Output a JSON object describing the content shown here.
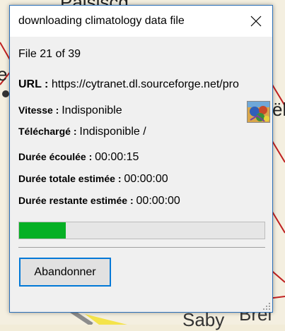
{
  "background_map": {
    "labels": [
      "Palsiscd",
      "e",
      "ël",
      "Saby",
      "Brei"
    ]
  },
  "dialog": {
    "title": "downloading climatology data file",
    "file_counter": "File 21 of 39",
    "url_label": "URL :",
    "url_value": "https://cytranet.dl.sourceforge.net/pro",
    "speed_label": "Vitesse :",
    "speed_value": "Indisponible",
    "downloaded_label": "Téléchargé :",
    "downloaded_value": "Indisponible /",
    "elapsed_label": "Durée écoulée :",
    "elapsed_value": "00:00:15",
    "total_label": "Durée totale estimée :",
    "total_value": "00:00:00",
    "remaining_label": "Durée restante estimée :",
    "remaining_value": "00:00:00",
    "progress_percent": 19,
    "abandon_label": "Abandonner",
    "accent_color": "#0078d7",
    "progress_color": "#06b025",
    "thumbnail_icon": "climatology-map-thumbnail-icon",
    "close_icon": "close-icon"
  }
}
